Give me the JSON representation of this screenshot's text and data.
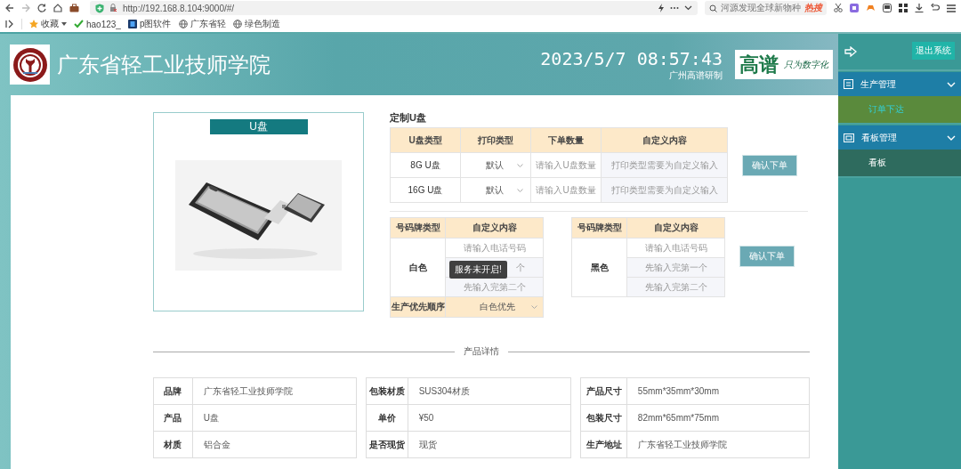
{
  "browser": {
    "url": "http://192.168.8.104:9000/#/",
    "search": {
      "placeholder": "河源发现全球新物种",
      "badge": "热搜"
    },
    "bookmarks": [
      {
        "label": "收藏",
        "kind": "star"
      },
      {
        "label": "hao123_",
        "kind": "check"
      },
      {
        "label": "p图软件",
        "kind": "app"
      },
      {
        "label": "广东省轻",
        "kind": "globe"
      },
      {
        "label": "绿色制造",
        "kind": "globe"
      }
    ]
  },
  "header": {
    "school_name": "广东省轻工业技师学院",
    "datetime": "2023/5/7 08:57:43",
    "credit": "广州高谱研制",
    "brand": "高谱",
    "slogan": "只为数字化"
  },
  "sidebar": {
    "logout": "退出系统",
    "groups": [
      {
        "label": "生产管理",
        "expanded": true,
        "items": [
          {
            "label": "订单下达",
            "selected": true
          }
        ]
      },
      {
        "label": "看板管理",
        "expanded": true,
        "items": [
          {
            "label": "看板",
            "selected": false
          }
        ]
      }
    ]
  },
  "product": {
    "title": "U盘"
  },
  "custom_usb": {
    "title": "定制U盘",
    "columns": [
      "U盘类型",
      "打印类型",
      "下单数量",
      "自定义内容"
    ],
    "rows": [
      {
        "type": "8G U盘",
        "print_type": "默认",
        "quantity_placeholder": "请输入U盘数量",
        "custom_placeholder": "打印类型需要为自定义输入"
      },
      {
        "type": "16G U盘",
        "print_type": "默认",
        "quantity_placeholder": "请输入U盘数量",
        "custom_placeholder": "打印类型需要为自定义输入"
      }
    ],
    "confirm": "确认下单"
  },
  "plates": {
    "tables": [
      {
        "columns": [
          "号码牌类型",
          "自定义内容"
        ],
        "color_label": "白色",
        "fields": [
          "请输入电话号码",
          "个",
          "先输入完第二个"
        ],
        "toast": "服务未开启!",
        "priority": {
          "label": "生产优先顺序",
          "placeholder": "白色优先"
        }
      },
      {
        "columns": [
          "号码牌类型",
          "自定义内容"
        ],
        "color_label": "黑色",
        "fields": [
          "请输入电话号码",
          "先输入完第一个",
          "先输入完第二个"
        ]
      }
    ],
    "confirm": "确认下单"
  },
  "details": {
    "title": "产品详情",
    "groups": [
      [
        {
          "label": "品牌",
          "value": "广东省轻工业技师学院"
        },
        {
          "label": "产品",
          "value": "U盘"
        },
        {
          "label": "材质",
          "value": "铝合金"
        }
      ],
      [
        {
          "label": "包装材质",
          "value": "SUS304材质"
        },
        {
          "label": "单价",
          "value": "¥50"
        },
        {
          "label": "是否现货",
          "value": "现货"
        }
      ],
      [
        {
          "label": "产品尺寸",
          "value": "55mm*35mm*30mm"
        },
        {
          "label": "包装尺寸",
          "value": "82mm*65mm*75mm"
        },
        {
          "label": "生产地址",
          "value": "广东省轻工业技师学院"
        }
      ]
    ]
  }
}
